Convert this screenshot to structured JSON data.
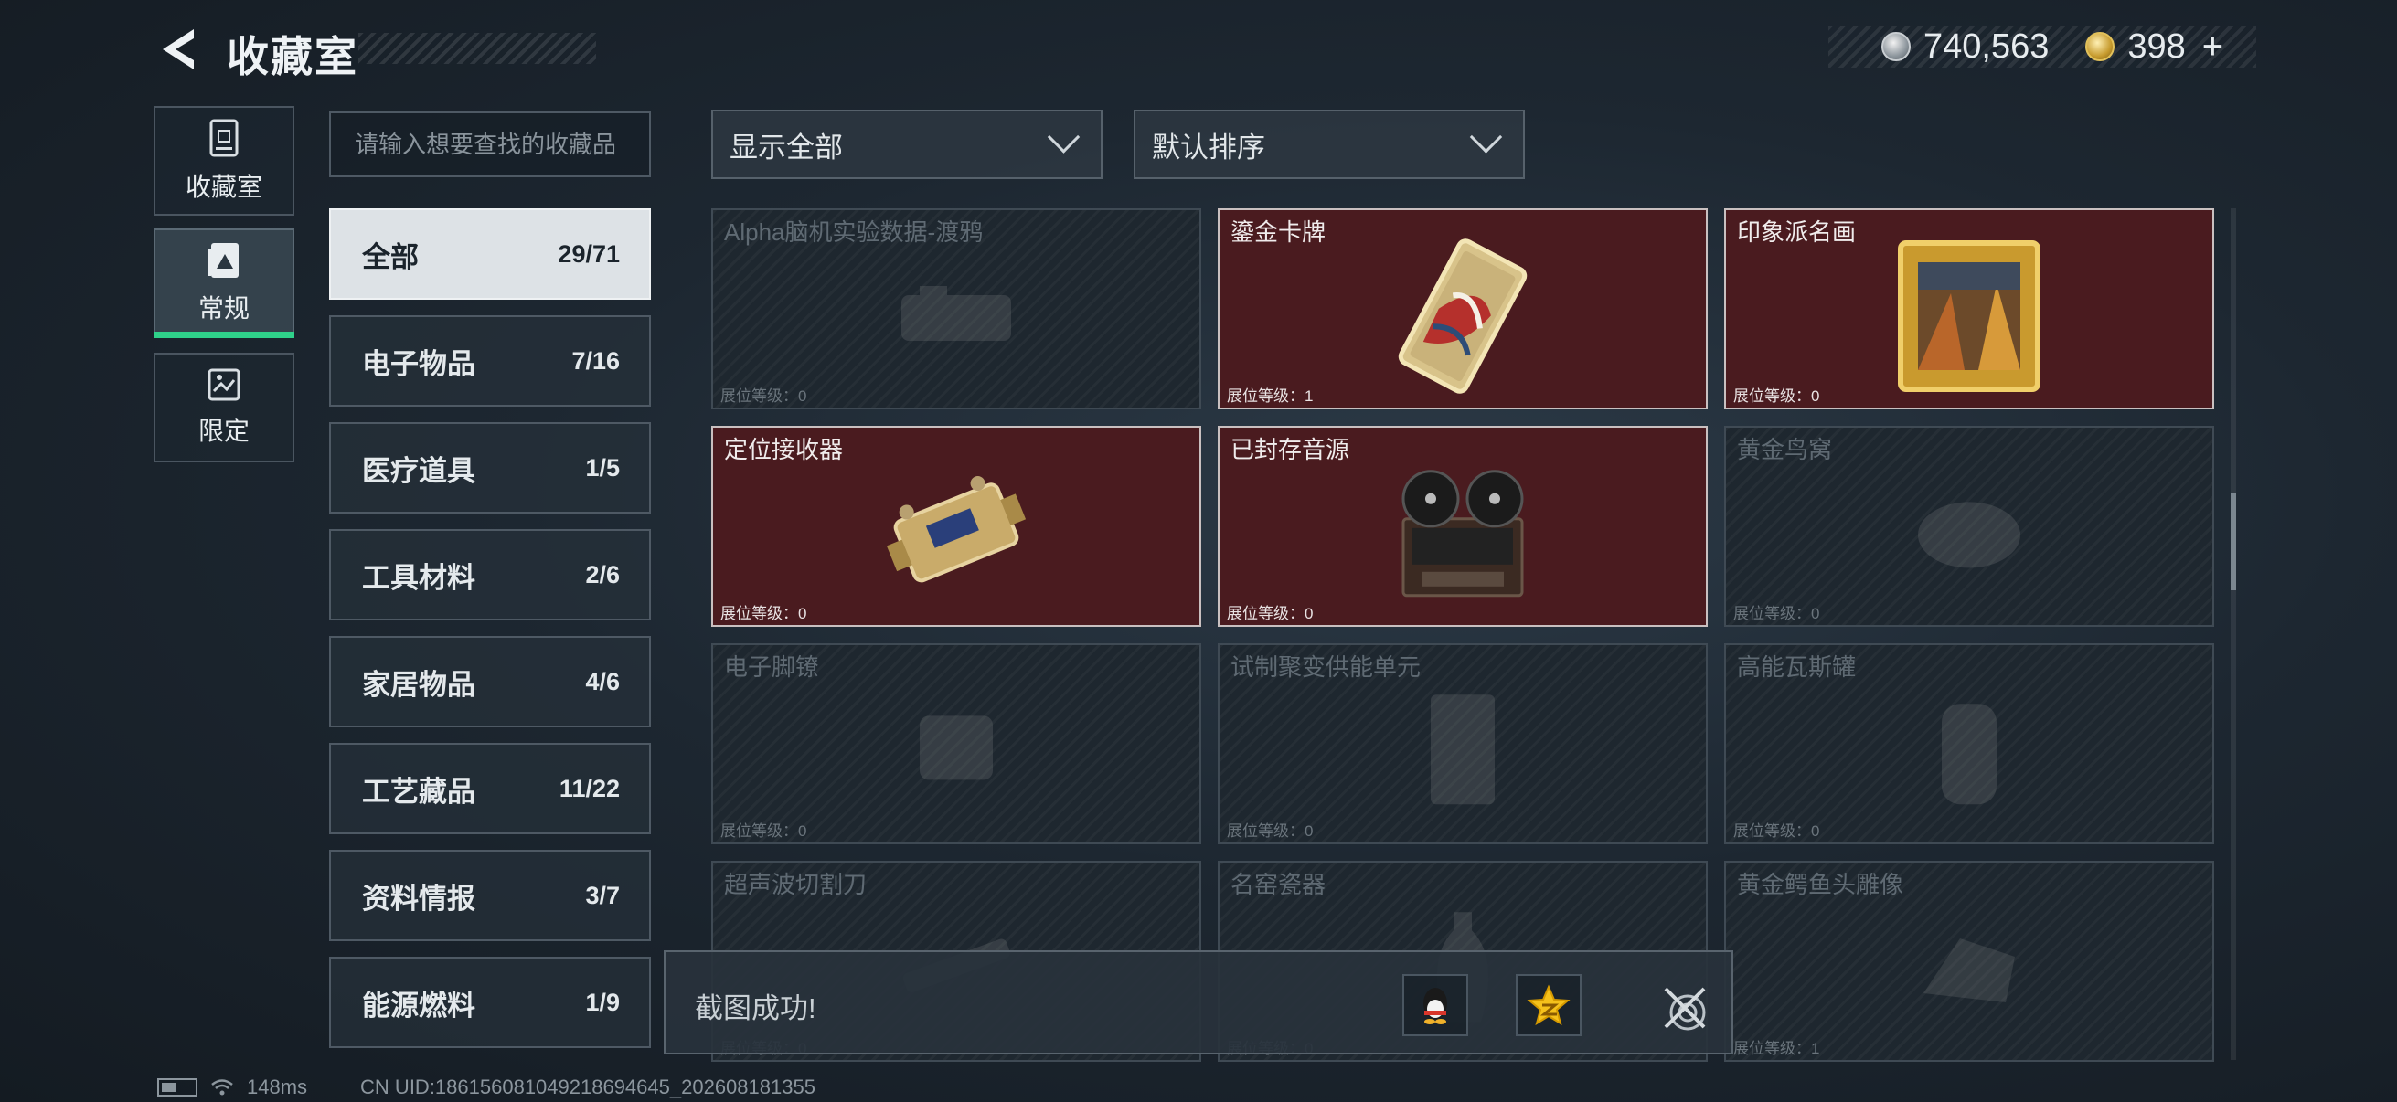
{
  "header": {
    "title": "收藏室",
    "currency": {
      "primary_value": "740,563",
      "secondary_value": "398",
      "add_symbol": "+"
    }
  },
  "nav": [
    {
      "label": "收藏室",
      "icon": "cabinet-icon",
      "active": false
    },
    {
      "label": "常规",
      "icon": "collection-card-icon",
      "active": true
    },
    {
      "label": "限定",
      "icon": "limited-map-icon",
      "active": false
    }
  ],
  "search": {
    "placeholder": "请输入想要查找的收藏品",
    "value": ""
  },
  "categories": [
    {
      "label": "全部",
      "count": "29/71",
      "active": true
    },
    {
      "label": "电子物品",
      "count": "7/16"
    },
    {
      "label": "医疗道具",
      "count": "1/5"
    },
    {
      "label": "工具材料",
      "count": "2/6"
    },
    {
      "label": "家居物品",
      "count": "4/6"
    },
    {
      "label": "工艺藏品",
      "count": "11/22"
    },
    {
      "label": "资料情报",
      "count": "3/7"
    },
    {
      "label": "能源燃料",
      "count": "1/9"
    }
  ],
  "filters": {
    "display": "显示全部",
    "sort": "默认排序"
  },
  "level_label": "展位等级：",
  "items": [
    {
      "name": "Alpha脑机实验数据-渡鸦",
      "level": "0",
      "owned": false,
      "icon": "data-drive-icon"
    },
    {
      "name": "鎏金卡牌",
      "level": "1",
      "owned": true,
      "icon": "gilded-card-icon"
    },
    {
      "name": "印象派名画",
      "level": "0",
      "owned": true,
      "icon": "framed-painting-icon"
    },
    {
      "name": "定位接收器",
      "level": "0",
      "owned": true,
      "icon": "gps-receiver-icon"
    },
    {
      "name": "已封存音源",
      "level": "0",
      "owned": true,
      "icon": "reel-tape-recorder-icon"
    },
    {
      "name": "黄金鸟窝",
      "level": "0",
      "owned": false,
      "icon": "golden-nest-icon"
    },
    {
      "name": "电子脚镣",
      "level": "0",
      "owned": false,
      "icon": "ankle-monitor-icon"
    },
    {
      "name": "试制聚变供能单元",
      "level": "0",
      "owned": false,
      "icon": "fusion-cell-icon"
    },
    {
      "name": "高能瓦斯罐",
      "level": "0",
      "owned": false,
      "icon": "gas-canister-icon"
    },
    {
      "name": "超声波切割刀",
      "level": "0",
      "owned": false,
      "icon": "ultrasonic-cutter-icon"
    },
    {
      "name": "名窑瓷器",
      "level": "0",
      "owned": false,
      "icon": "porcelain-vase-icon"
    },
    {
      "name": "黄金鳄鱼头雕像",
      "level": "1",
      "owned": false,
      "icon": "golden-crocodile-icon"
    }
  ],
  "colors": {
    "owned_bg": "#4a1b1f",
    "active_tab_accent": "#2fd18a",
    "unowned_bg": "#1e272f"
  },
  "toast": {
    "text": "截图成功!"
  },
  "footer": {
    "ping": "148ms",
    "uid": "CN UID:18615608104921869464​5_202608181355"
  }
}
